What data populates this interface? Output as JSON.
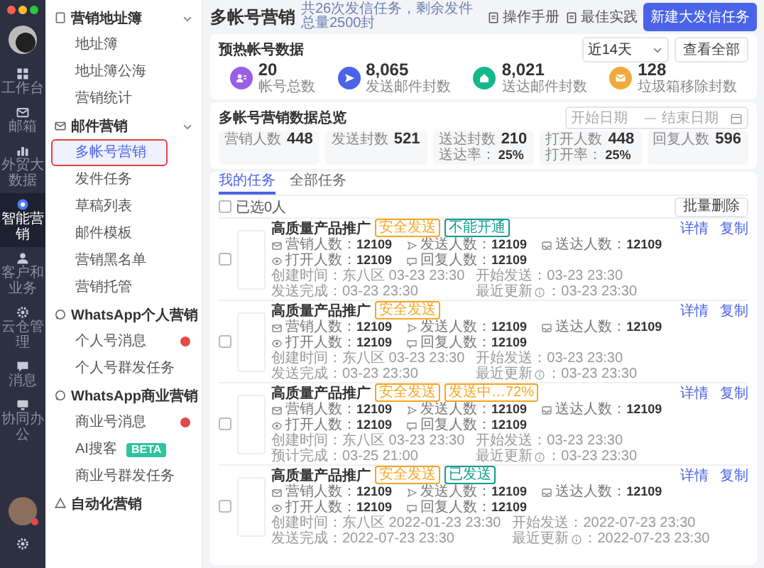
{
  "rail": {
    "items": [
      {
        "label": "工作台",
        "selected": false
      },
      {
        "label": "邮箱",
        "selected": false
      },
      {
        "label": "外贸大数据",
        "selected": false
      },
      {
        "label": "智能营销",
        "selected": true
      },
      {
        "label": "客户和业务",
        "selected": false
      },
      {
        "label": "云仓管理",
        "selected": false
      },
      {
        "label": "消息",
        "selected": false
      },
      {
        "label": "协同办公",
        "selected": false
      }
    ]
  },
  "menu": [
    {
      "label": "营销地址簿",
      "items": [
        {
          "label": "地址簿",
          "selected": false
        },
        {
          "label": "地址簿公海",
          "selected": false
        },
        {
          "label": "营销统计",
          "selected": false
        }
      ]
    },
    {
      "label": "邮件营销",
      "items": [
        {
          "label": "多帐号营销",
          "selected": true
        },
        {
          "label": "发件任务",
          "selected": false
        },
        {
          "label": "草稿列表",
          "selected": false
        },
        {
          "label": "邮件模板",
          "selected": false
        },
        {
          "label": "营销黑名单",
          "selected": false
        },
        {
          "label": "营销托管",
          "selected": false
        }
      ]
    },
    {
      "label": "WhatsApp个人营销",
      "items": [
        {
          "label": "个人号消息",
          "selected": false,
          "unread": true
        },
        {
          "label": "个人号群发任务",
          "selected": false
        }
      ]
    },
    {
      "label": "WhatsApp商业营销",
      "items": [
        {
          "label": "商业号消息",
          "selected": false,
          "unread": true
        },
        {
          "label": "AI搜客",
          "selected": false,
          "tag": "BETA"
        },
        {
          "label": "商业号群发任务",
          "selected": false
        }
      ]
    },
    {
      "label": "自动化营销"
    }
  ],
  "header": {
    "title": "多帐号营销",
    "subtitle": "共26次发信任务，剩余发件总量2500封",
    "links": [
      {
        "label": "操作手册"
      },
      {
        "label": "最佳实践"
      }
    ],
    "primary_button": "新建大发信任务"
  },
  "warmup": {
    "title": "预热帐号数据",
    "range_select": "近14天",
    "view_all_button": "查看全部",
    "stats": [
      {
        "value": "20",
        "label": "帐号总数",
        "color": "#9b5de5"
      },
      {
        "value": "8,065",
        "label": "发送邮件封数",
        "color": "#4a63e7"
      },
      {
        "value": "8,021",
        "label": "送达邮件封数",
        "color": "#14b88a"
      },
      {
        "value": "128",
        "label": "垃圾箱移除封数",
        "color": "#f2a93b"
      }
    ]
  },
  "overview": {
    "title": "多帐号营销数据总览",
    "date_start_placeholder": "开始日期",
    "date_end_placeholder": "结束日期",
    "metrics": [
      {
        "label": "营销人数",
        "value": "448"
      },
      {
        "label": "发送封数",
        "value": "521"
      },
      {
        "label": "送达封数",
        "value": "210",
        "rate_label": "送达率：",
        "rate": "25%"
      },
      {
        "label": "打开人数",
        "value": "448",
        "rate_label": "打开率：",
        "rate": "25%"
      },
      {
        "label": "回复人数",
        "value": "596"
      }
    ]
  },
  "tasks_panel": {
    "tabs": [
      {
        "label": "我的任务",
        "selected": true
      },
      {
        "label": "全部任务",
        "selected": false
      }
    ],
    "select_all": {
      "label": "已选0人",
      "checked": false
    },
    "bulk_delete_button": "批量删除",
    "tasks": [
      {
        "title": "高质量产品推广",
        "checked": false,
        "tags": [
          {
            "text": "安全发送",
            "color": "#f5a623"
          },
          {
            "text": "不能开通",
            "color": "#109c8c"
          }
        ],
        "metrics": [
          {
            "label": "营销人数：",
            "value": "12109"
          },
          {
            "label": "发送人数：",
            "value": "12109"
          },
          {
            "label": "送达人数：",
            "value": "12109"
          },
          {
            "label": "打开人数：",
            "value": "12109"
          },
          {
            "label": "回复人数：",
            "value": "12109"
          }
        ],
        "times": [
          {
            "label": "创建时间：",
            "value": "东八区 03-23 23:30"
          },
          {
            "label": "开始发送：",
            "value": "03-23 23:30"
          },
          {
            "label": "发送完成：",
            "value": "03-23 23:30"
          },
          {
            "label": "最近更新",
            "info": true,
            "value": "：03-23 23:30"
          }
        ],
        "actions": [
          "详情",
          "复制"
        ]
      },
      {
        "title": "高质量产品推广",
        "checked": false,
        "tags": [
          {
            "text": "安全发送",
            "color": "#f5a623"
          }
        ],
        "metrics": [
          {
            "label": "营销人数：",
            "value": "12109"
          },
          {
            "label": "发送人数：",
            "value": "12109"
          },
          {
            "label": "送达人数：",
            "value": "12109"
          },
          {
            "label": "打开人数：",
            "value": "12109"
          },
          {
            "label": "回复人数：",
            "value": "12109"
          }
        ],
        "times": [
          {
            "label": "创建时间：",
            "value": "东八区 03-23 23:30"
          },
          {
            "label": "开始发送：",
            "value": "03-23 23:30"
          },
          {
            "label": "发送完成：",
            "value": "03-23 23:30"
          },
          {
            "label": "最近更新",
            "info": true,
            "value": "：03-23 23:30"
          }
        ],
        "actions": [
          "详情",
          "复制"
        ]
      },
      {
        "title": "高质量产品推广",
        "checked": false,
        "tags": [
          {
            "text": "安全发送",
            "color": "#f5a623"
          },
          {
            "text": "发送中…72%",
            "color": "#f5a623"
          }
        ],
        "metrics": [
          {
            "label": "营销人数：",
            "value": "12109"
          },
          {
            "label": "发送人数：",
            "value": "12109"
          },
          {
            "label": "送达人数：",
            "value": "12109"
          },
          {
            "label": "打开人数：",
            "value": "12109"
          },
          {
            "label": "回复人数：",
            "value": "12109"
          }
        ],
        "times": [
          {
            "label": "创建时间：",
            "value": "东八区 03-23 23:30"
          },
          {
            "label": "开始发送：",
            "value": "03-23 23:30"
          },
          {
            "label": "预计完成：",
            "value": "03-25 21:00"
          },
          {
            "label": "最近更新",
            "info": true,
            "value": "：03-23 23:30"
          }
        ],
        "actions": [
          "详情",
          "复制"
        ]
      },
      {
        "title": "高质量产品推广",
        "checked": false,
        "tags": [
          {
            "text": "安全发送",
            "color": "#f5a623"
          },
          {
            "text": "已发送",
            "color": "#109c8c"
          }
        ],
        "metrics": [
          {
            "label": "营销人数：",
            "value": "12109"
          },
          {
            "label": "发送人数：",
            "value": "12109"
          },
          {
            "label": "送达人数：",
            "value": "12109"
          },
          {
            "label": "打开人数：",
            "value": "12109"
          },
          {
            "label": "回复人数：",
            "value": "12109"
          }
        ],
        "times": [
          {
            "label": "创建时间：",
            "value": "东八区 2022-01-23 23:30"
          },
          {
            "label": "开始发送：",
            "value": "2022-07-23 23:30"
          },
          {
            "label": "发送完成：",
            "value": "2022-07-23 23:30"
          },
          {
            "label": "最近更新",
            "info": true,
            "value": "：2022-07-23 23:30"
          }
        ],
        "actions": [
          "详情",
          "复制"
        ]
      }
    ]
  }
}
